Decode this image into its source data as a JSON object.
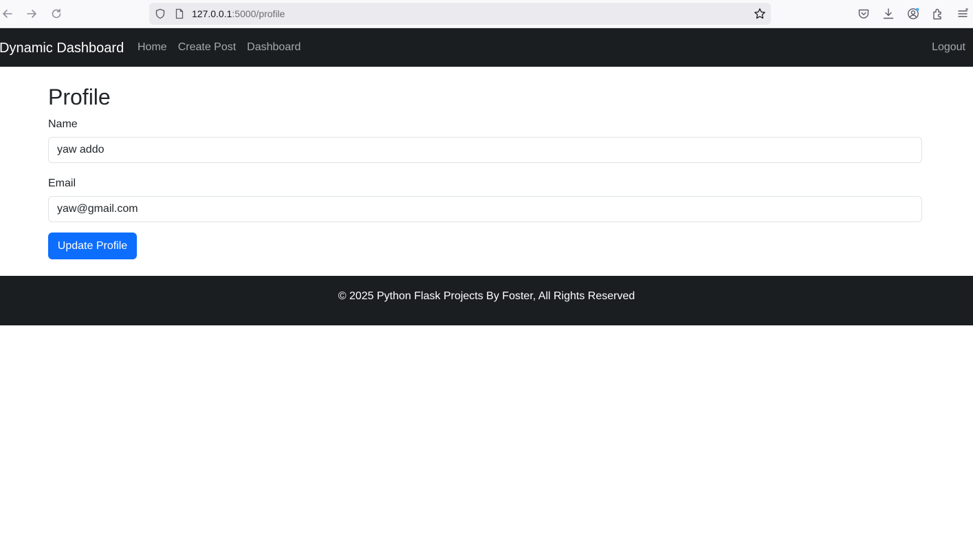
{
  "browser": {
    "url_host": "127.0.0.1",
    "url_path": ":5000/profile",
    "icons": [
      "back-icon",
      "forward-icon",
      "reload-icon",
      "shield-icon",
      "page-icon",
      "bookmark-star-icon",
      "pocket-icon",
      "downloads-icon",
      "account-icon",
      "extensions-icon",
      "menu-icon"
    ]
  },
  "navbar": {
    "brand": "Dynamic Dashboard",
    "links": [
      {
        "label": "Home"
      },
      {
        "label": "Create Post"
      },
      {
        "label": "Dashboard"
      }
    ],
    "logout": "Logout"
  },
  "main": {
    "title": "Profile",
    "form": {
      "name_label": "Name",
      "name_value": "yaw addo",
      "email_label": "Email",
      "email_value": "yaw@gmail.com",
      "submit_label": "Update Profile"
    }
  },
  "footer": {
    "text": "© 2025 Python Flask Projects By Foster, All Rights Reserved"
  },
  "colors": {
    "navbar_bg": "#1b1e21",
    "primary": "#0d6efd",
    "nav_link": "#a6a9ad"
  }
}
